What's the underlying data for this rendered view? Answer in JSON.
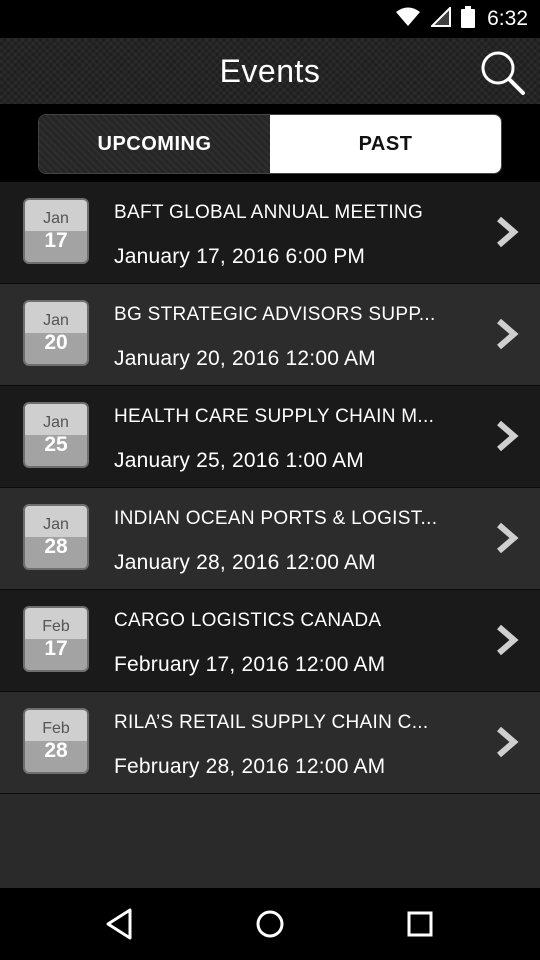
{
  "status_bar": {
    "time": "6:32",
    "icons": [
      "wifi-icon",
      "signal-icon",
      "battery-icon"
    ]
  },
  "header": {
    "title": "Events",
    "search_icon": "search-icon"
  },
  "tabs": {
    "upcoming_label": "UPCOMING",
    "past_label": "PAST",
    "selected": "PAST"
  },
  "events": [
    {
      "month": "Jan",
      "day": "17",
      "name": "BAFT GLOBAL ANNUAL MEETING",
      "datetime": "January 17, 2016 6:00 PM"
    },
    {
      "month": "Jan",
      "day": "20",
      "name": "BG STRATEGIC ADVISORS SUPP...",
      "datetime": "January 20, 2016 12:00 AM"
    },
    {
      "month": "Jan",
      "day": "25",
      "name": "HEALTH CARE SUPPLY CHAIN M...",
      "datetime": "January 25, 2016 1:00 AM"
    },
    {
      "month": "Jan",
      "day": "28",
      "name": "INDIAN OCEAN PORTS & LOGIST...",
      "datetime": "January 28, 2016 12:00 AM"
    },
    {
      "month": "Feb",
      "day": "17",
      "name": "CARGO LOGISTICS CANADA",
      "datetime": "February 17, 2016 12:00 AM"
    },
    {
      "month": "Feb",
      "day": "28",
      "name": "RILA’S RETAIL SUPPLY CHAIN C...",
      "datetime": "February 28, 2016 12:00 AM"
    }
  ],
  "nav": {
    "icons": [
      "back-icon",
      "home-icon",
      "recents-icon"
    ]
  },
  "colors": {
    "row_dark": "#1a1a1a",
    "row_light": "#2c2c2c",
    "selected_tab": "#ffffff"
  }
}
